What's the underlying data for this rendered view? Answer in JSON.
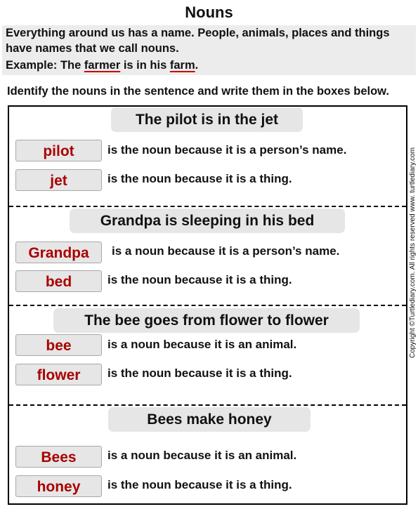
{
  "title": "Nouns",
  "intro": {
    "line1": "Everything around us has a name. People, animals, places and things",
    "line2": "have names that we call nouns.",
    "example_prefix": "Example: The ",
    "example_noun1": "farmer",
    "example_middle": " is in his ",
    "example_noun2": "farm",
    "example_suffix": "."
  },
  "instruction": "Identify the nouns in the sentence and write them in the boxes below.",
  "sections": [
    {
      "sentence": "The pilot is in the jet",
      "answers": [
        {
          "noun": "pilot",
          "reason": "is the noun because it is a person’s name."
        },
        {
          "noun": "jet",
          "reason": "is the noun because it is a thing."
        }
      ]
    },
    {
      "sentence": "Grandpa is sleeping in his bed",
      "answers": [
        {
          "noun": "Grandpa",
          "reason": "is a noun because it is a person’s name."
        },
        {
          "noun": "bed",
          "reason": "is the noun because it is a thing."
        }
      ]
    },
    {
      "sentence": "The bee goes from flower to flower",
      "answers": [
        {
          "noun": "bee",
          "reason": "is a noun because it is an animal."
        },
        {
          "noun": "flower",
          "reason": "is the noun because it is a thing."
        }
      ]
    },
    {
      "sentence": "Bees make honey",
      "answers": [
        {
          "noun": "Bees",
          "reason": "is a noun because it is an animal."
        },
        {
          "noun": "honey",
          "reason": "is the noun because it is a thing."
        }
      ]
    }
  ],
  "copyright": "Copyright ©Turtlediary.com. All rights reserved   www. turtlediary.com",
  "colors": {
    "answer_text": "#aa0000",
    "underline": "#cc0000",
    "panel_bg": "#ececec",
    "box_bg": "#e6e6e6"
  }
}
